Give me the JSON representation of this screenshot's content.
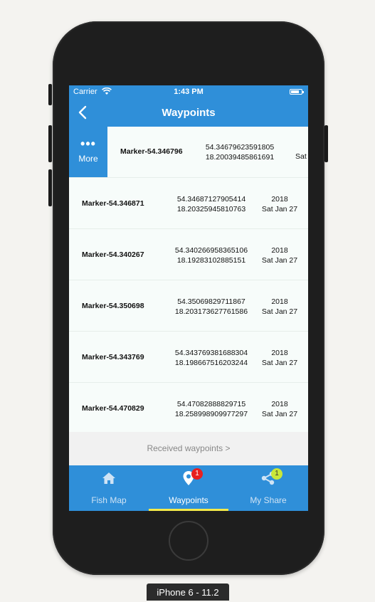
{
  "status_bar": {
    "carrier": "Carrier",
    "time": "1:43 PM"
  },
  "nav": {
    "title": "Waypoints",
    "back_icon": "chevron-left-icon"
  },
  "swipe_action": {
    "label": "More",
    "icon": "more-dots-icon"
  },
  "waypoints": [
    {
      "name": "Marker-54.346796",
      "lat": "54.34679623591805",
      "lon": "18.20039485861691",
      "year": "",
      "day": "Sat"
    },
    {
      "name": "Marker-54.346871",
      "lat": "54.34687127905414",
      "lon": "18.20325945810763",
      "year": "2018",
      "day": "Sat Jan 27"
    },
    {
      "name": "Marker-54.340267",
      "lat": "54.340266958365106",
      "lon": "18.19283102885151",
      "year": "2018",
      "day": "Sat Jan 27"
    },
    {
      "name": "Marker-54.350698",
      "lat": "54.35069829711867",
      "lon": "18.203173627761586",
      "year": "2018",
      "day": "Sat Jan 27"
    },
    {
      "name": "Marker-54.343769",
      "lat": "54.343769381688304",
      "lon": "18.198667516203244",
      "year": "2018",
      "day": "Sat Jan 27"
    },
    {
      "name": "Marker-54.470829",
      "lat": "54.47082888829715",
      "lon": "18.258998909977297",
      "year": "2018",
      "day": "Sat Jan 27"
    }
  ],
  "received_link": "Received waypoints >",
  "tabs": [
    {
      "label": "Fish Map",
      "icon": "home-icon",
      "badge": ""
    },
    {
      "label": "Waypoints",
      "icon": "map-pin-icon",
      "badge": "1"
    },
    {
      "label": "My Share",
      "icon": "share-icon",
      "badge": "1"
    }
  ],
  "device_label": "iPhone 6 - 11.2",
  "colors": {
    "primary": "#2f8fd9",
    "active_underline": "#f3e94a",
    "badge_red": "#e82020",
    "badge_yellow": "#c9e73a"
  }
}
